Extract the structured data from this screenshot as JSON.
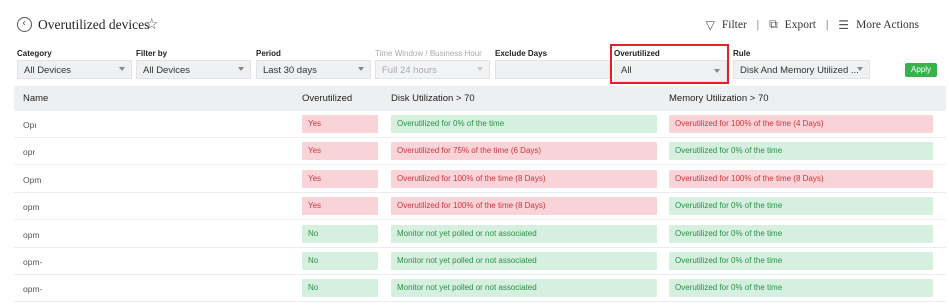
{
  "header": {
    "title": "Overutilized devices",
    "actions": {
      "filter": "Filter",
      "export": "Export",
      "more": "More Actions"
    }
  },
  "filters": {
    "category": {
      "label": "Category",
      "value": "All Devices"
    },
    "filter_by": {
      "label": "Filter by",
      "value": "All Devices"
    },
    "period": {
      "label": "Period",
      "value": "Last 30 days"
    },
    "time_window": {
      "label": "Time Window / Business Hour",
      "value": "Full 24 hours"
    },
    "exclude_days": {
      "label": "Exclude Days",
      "value": ""
    },
    "overutilized": {
      "label": "Overutilized",
      "value": "All"
    },
    "rule": {
      "label": "Rule",
      "value": "Disk And Memory Utilized ..."
    },
    "apply_label": "Apply"
  },
  "table": {
    "headers": {
      "name": "Name",
      "overutilized": "Overutilized",
      "disk": "Disk Utilization > 70",
      "memory": "Memory Utilization > 70"
    },
    "rows": [
      {
        "name": "Opı",
        "over": "Yes",
        "over_status": "red",
        "disk": "Overutilized for 0% of the time",
        "disk_status": "green",
        "mem": "Overutilized for 100% of the time (4 Days)",
        "mem_status": "red"
      },
      {
        "name": "opr",
        "over": "Yes",
        "over_status": "red",
        "disk": "Overutilized for 75% of the time (6 Days)",
        "disk_status": "red",
        "mem": "Overutilized for 0% of the time",
        "mem_status": "green"
      },
      {
        "name": "Opm",
        "over": "Yes",
        "over_status": "red",
        "disk": "Overutilized for 100% of the time (8 Days)",
        "disk_status": "red",
        "mem": "Overutilized for 100% of the time (8 Days)",
        "mem_status": "red"
      },
      {
        "name": "opm",
        "over": "Yes",
        "over_status": "red",
        "disk": "Overutilized for 100% of the time (8 Days)",
        "disk_status": "red",
        "mem": "Overutilized for 0% of the time",
        "mem_status": "green"
      },
      {
        "name": "opm",
        "over": "No",
        "over_status": "green",
        "disk": "Monitor not yet polled or not associated",
        "disk_status": "green",
        "mem": "Overutilized for 0% of the time",
        "mem_status": "green"
      },
      {
        "name": "opm-",
        "over": "No",
        "over_status": "green",
        "disk": "Monitor not yet polled or not associated",
        "disk_status": "green",
        "mem": "Overutilized for 0% of the time",
        "mem_status": "green"
      },
      {
        "name": "opm-",
        "over": "No",
        "over_status": "green",
        "disk": "Monitor not yet polled or not associated",
        "disk_status": "green",
        "mem": "Overutilized for 0% of the time",
        "mem_status": "green"
      }
    ]
  }
}
